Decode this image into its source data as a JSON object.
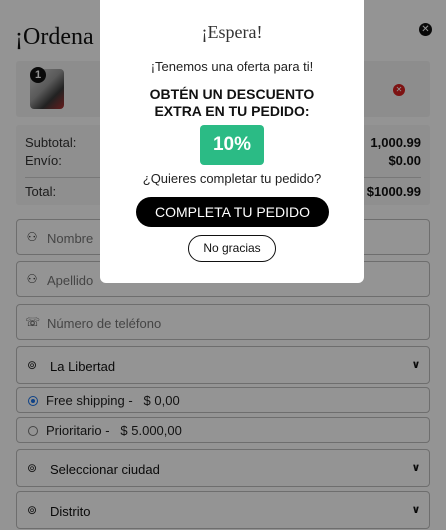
{
  "form": {
    "title": "¡Ordena",
    "close_icon": "close-icon",
    "product": {
      "quantity": "1",
      "remove_icon": "remove-icon"
    },
    "summary": {
      "subtotal_label": "Subtotal:",
      "subtotal_value": "1,000.99",
      "shipping_label": "Envío:",
      "shipping_value": "$0.00",
      "total_label": "Total:",
      "total_value": "$1000.99"
    },
    "fields": {
      "first_name_placeholder": "Nombre",
      "last_name_placeholder": "Apellido",
      "phone_placeholder": "Número de teléfono",
      "region_value": "La Libertad",
      "city_value": "Seleccionar ciudad",
      "district_value": "Distrito"
    },
    "shipping_options": [
      {
        "label": "Free shipping -   $ 0,00",
        "selected": true
      },
      {
        "label": "Prioritario -   $ 5.000,00",
        "selected": false
      }
    ]
  },
  "modal": {
    "title": "¡Espera!",
    "offer_text": "¡Tenemos una oferta para ti!",
    "headline_line1": "OBTÉN UN DESCUENTO",
    "headline_line2": "EXTRA EN TU PEDIDO:",
    "discount": "10%",
    "question": "¿Quieres completar tu pedido?",
    "cta_label": "COMPLETA TU PEDIDO",
    "decline_label": "No gracias"
  },
  "colors": {
    "overlay": "#000000",
    "discount_badge": "#2bbb85",
    "cta_background": "#000000",
    "remove_icon": "#d81f1f",
    "radio_selected": "#1a73e8"
  }
}
